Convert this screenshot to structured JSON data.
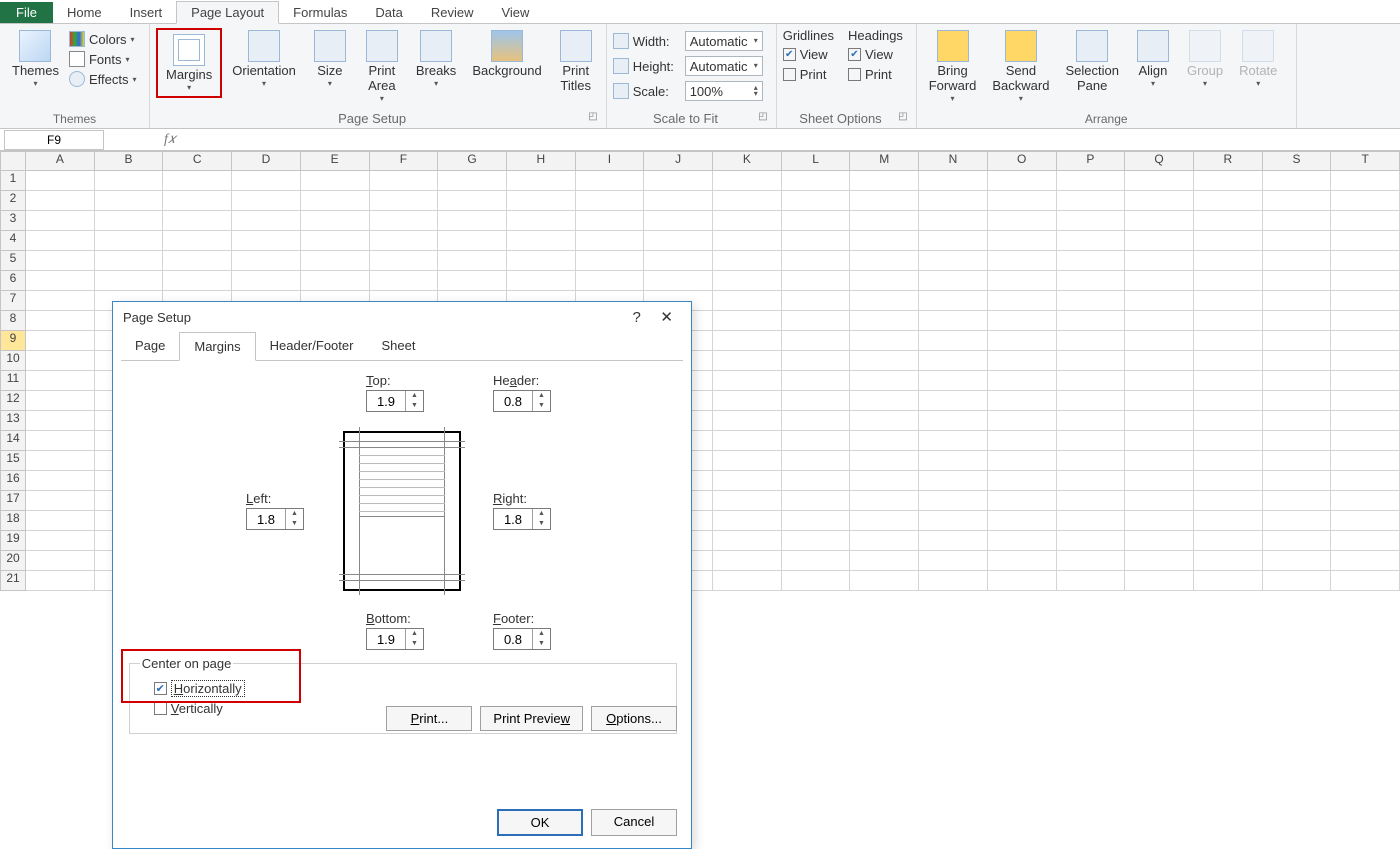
{
  "ribbon": {
    "file_tab": "File",
    "tabs": [
      "Home",
      "Insert",
      "Page Layout",
      "Formulas",
      "Data",
      "Review",
      "View"
    ],
    "active_tab_index": 2,
    "groups": {
      "themes": {
        "title": "Themes",
        "big": "Themes",
        "colors": "Colors",
        "fonts": "Fonts",
        "effects": "Effects"
      },
      "page_setup": {
        "title": "Page Setup",
        "margins": "Margins",
        "orientation": "Orientation",
        "size": "Size",
        "print_area": "Print\nArea",
        "breaks": "Breaks",
        "background": "Background",
        "print_titles": "Print\nTitles"
      },
      "scale": {
        "title": "Scale to Fit",
        "width_label": "Width:",
        "height_label": "Height:",
        "scale_label": "Scale:",
        "width_value": "Automatic",
        "height_value": "Automatic",
        "scale_value": "100%"
      },
      "sheet_options": {
        "title": "Sheet Options",
        "gridlines": "Gridlines",
        "headings": "Headings",
        "view": "View",
        "print": "Print"
      },
      "arrange": {
        "title": "Arrange",
        "bring_forward": "Bring\nForward",
        "send_backward": "Send\nBackward",
        "selection_pane": "Selection\nPane",
        "align": "Align",
        "group": "Group",
        "rotate": "Rotate"
      }
    }
  },
  "name_box": "F9",
  "columns": [
    "A",
    "B",
    "C",
    "D",
    "E",
    "F",
    "G",
    "H",
    "I",
    "J",
    "K",
    "L",
    "M",
    "N",
    "O",
    "P",
    "Q",
    "R",
    "S",
    "T"
  ],
  "row_count": 21,
  "active_row": 9,
  "dialog": {
    "title": "Page Setup",
    "tabs": [
      "Page",
      "Margins",
      "Header/Footer",
      "Sheet"
    ],
    "active_tab_index": 1,
    "margins": {
      "top_label": "Top:",
      "top_value": "1.9",
      "header_label": "Header:",
      "header_value": "0.8",
      "left_label": "Left:",
      "left_value": "1.8",
      "right_label": "Right:",
      "right_value": "1.8",
      "bottom_label": "Bottom:",
      "bottom_value": "1.9",
      "footer_label": "Footer:",
      "footer_value": "0.8"
    },
    "center_group_label": "Center on page",
    "horizontally_label": "Horizontally",
    "vertically_label": "Vertically",
    "horizontally_checked": true,
    "vertically_checked": false,
    "buttons": {
      "print": "Print...",
      "preview": "Print Preview",
      "options": "Options...",
      "ok": "OK",
      "cancel": "Cancel"
    },
    "help_symbol": "?",
    "close_symbol": "✕"
  }
}
